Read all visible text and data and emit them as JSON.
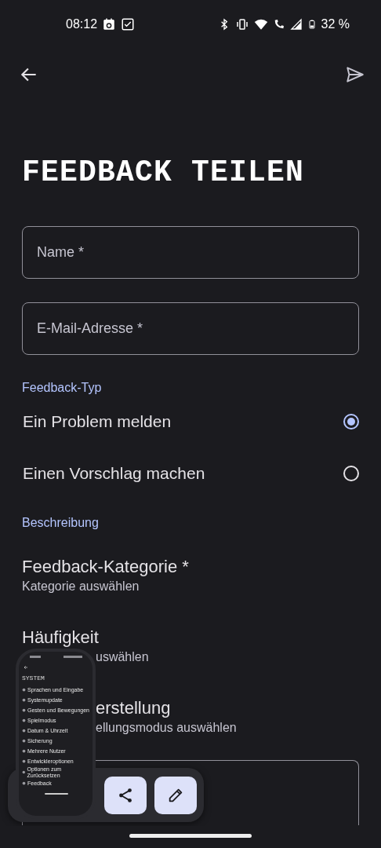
{
  "status_bar": {
    "time": "08:12",
    "battery": "32 %"
  },
  "title": "FEEDBACK TEILEN",
  "fields": [
    {
      "placeholder": "Name *"
    },
    {
      "placeholder": "E-Mail-Adresse *"
    }
  ],
  "feedback_type": {
    "label": "Feedback-Typ",
    "options": [
      {
        "label": "Ein Problem melden",
        "selected": true
      },
      {
        "label": "Einen Vorschlag machen",
        "selected": false
      }
    ]
  },
  "description": {
    "label": "Beschreibung",
    "items": [
      {
        "title": "Feedback-Kategorie *",
        "subtitle": "Kategorie auswählen"
      },
      {
        "title": "Häufigkeit",
        "subtitle": "uswählen"
      },
      {
        "title": "erstellung",
        "subtitle": "ellungsmodus auswählen"
      }
    ]
  },
  "screenshot_preview": {
    "title": "SYSTEM",
    "items": [
      "Sprachen und Eingabe",
      "Systemupdate",
      "Gesten und Bewegungen",
      "Spielmodus",
      "Datum & Uhrzeit",
      "Sicherung",
      "Mehrere Nutzer",
      "Entwickleroptionen",
      "Optionen zum Zurücksetzen",
      "Feedback"
    ]
  }
}
